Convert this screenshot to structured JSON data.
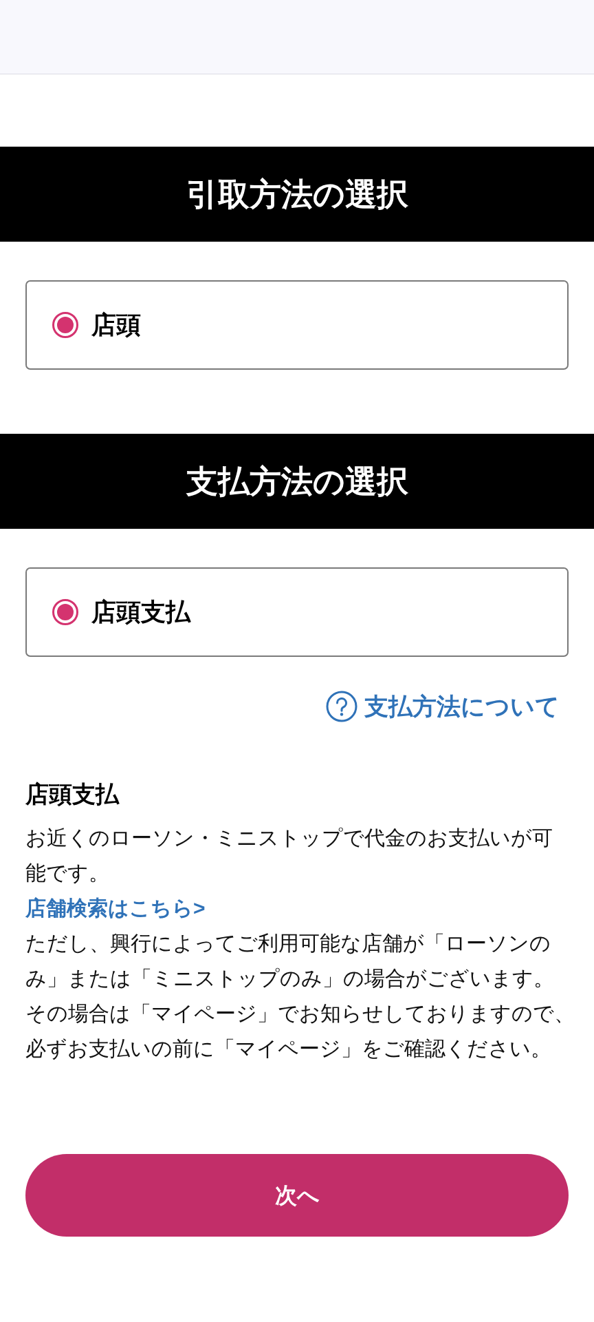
{
  "sections": [
    {
      "title": "引取方法の選択",
      "options": [
        {
          "label": "店頭",
          "selected": true
        }
      ]
    },
    {
      "title": "支払方法の選択",
      "options": [
        {
          "label": "店頭支払",
          "selected": true
        }
      ],
      "help_link": "支払方法について"
    }
  ],
  "description": {
    "heading": "店頭支払",
    "blocks": [
      {
        "kind": "text",
        "text": "お近くのローソン・ミニストップで代金のお支払いが可能です。"
      },
      {
        "kind": "link",
        "text": "店舗検索はこちら>"
      },
      {
        "kind": "text",
        "text": "ただし、興行によってご利用可能な店舗が「ローソンのみ」または「ミニストップのみ」の場合がございます。"
      },
      {
        "kind": "text",
        "text": "その場合は「マイページ」でお知らせしておりますので、必ずお支払いの前に「マイページ」をご確認ください。"
      }
    ]
  },
  "next_button": "次へ"
}
